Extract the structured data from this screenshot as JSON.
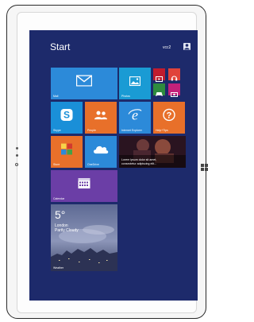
{
  "colors": {
    "screen_bg": "#1d2a6b",
    "tile_blue": "#2c8ad9",
    "tile_teal": "#1a9bd4",
    "tile_orange": "#e8702a",
    "tile_purple": "#6b3ea6",
    "tile_red": "#d1202a",
    "tile_green": "#2e8b3e"
  },
  "start": {
    "title": "Start",
    "user_name": "vcc2",
    "user_icon": "user-icon"
  },
  "tiles": {
    "mail": {
      "label": "Mail",
      "icon": "mail-icon"
    },
    "photos": {
      "label": "Photos",
      "icon": "photos-icon"
    },
    "video": {
      "icon": "video-icon"
    },
    "music": {
      "icon": "music-icon"
    },
    "games": {
      "icon": "games-icon"
    },
    "camera": {
      "icon": "camera-icon"
    },
    "skype": {
      "label": "Skype",
      "icon": "skype-icon"
    },
    "people": {
      "label": "People",
      "icon": "people-icon"
    },
    "ie": {
      "label": "Internet Explorer",
      "icon": "ie-icon"
    },
    "help": {
      "label": "Help+Tips",
      "icon": "help-icon"
    },
    "store": {
      "label": "Store",
      "icon": "store-icon"
    },
    "onedrive": {
      "label": "OneDrive",
      "icon": "cloud-icon"
    },
    "news": {
      "text": "Lorem ipsum dolor sit amet, consectetur adipiscing elit..."
    },
    "calendar": {
      "label": "Calendar",
      "icon": "calendar-icon"
    },
    "weather": {
      "temp": "5°",
      "city": "London",
      "desc": "Partly Cloudy",
      "label": "Weather"
    }
  }
}
